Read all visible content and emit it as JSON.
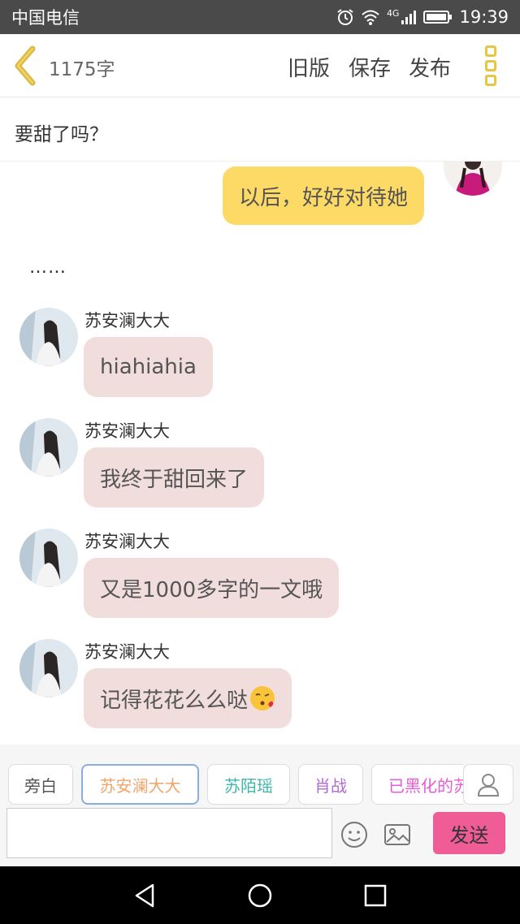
{
  "status_bar": {
    "carrier": "中国电信",
    "network": "4G",
    "time": "19:39"
  },
  "header": {
    "word_count": "1175字",
    "old_version": "旧版",
    "save": "保存",
    "publish": "发布"
  },
  "story": {
    "title": "要甜了吗？"
  },
  "chat": {
    "messages": [
      {
        "side": "right",
        "text": "以后，好好对待她"
      },
      {
        "type": "narration",
        "text": "……"
      },
      {
        "side": "left",
        "speaker": "苏安澜大大",
        "text": "hiahiahia"
      },
      {
        "side": "left",
        "speaker": "苏安澜大大",
        "text": "我终于甜回来了"
      },
      {
        "side": "left",
        "speaker": "苏安澜大大",
        "text": "又是1000多字的一文哦"
      },
      {
        "side": "left",
        "speaker": "苏安澜大大",
        "text": "记得花花么么哒",
        "emoji": "kissing-face-emoji"
      }
    ]
  },
  "roles": {
    "tabs": [
      {
        "label": "旁白",
        "color": "#555555"
      },
      {
        "label": "苏安澜大大",
        "color": "#f0a46a",
        "selected": true
      },
      {
        "label": "苏陌瑶",
        "color": "#3bb8a8"
      },
      {
        "label": "肖战",
        "color": "#b36ad0"
      },
      {
        "label": "已黑化的苏",
        "color": "#e75ad8"
      }
    ]
  },
  "composer": {
    "input_value": "",
    "send_label": "发送"
  },
  "colors": {
    "right_bubble": "#fdd966",
    "left_bubble": "#f2dddd",
    "send": "#f05c96",
    "accent": "#e8c544"
  }
}
